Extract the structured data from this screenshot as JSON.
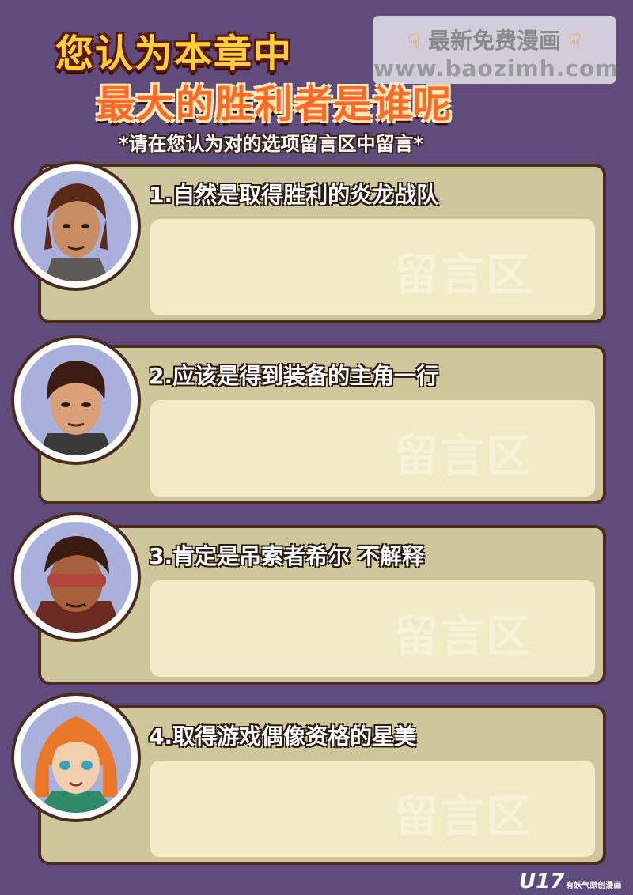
{
  "header": {
    "title_line1": "您认为本章中",
    "title_line2": "最大的胜利者是谁呢",
    "subtitle": "*请在您认为对的选项留言区中留言*"
  },
  "watermark": {
    "line1": "最新免费漫画",
    "line2": "www.baozimh.com"
  },
  "options": [
    {
      "label": "1.自然是取得胜利的炎龙战队",
      "comment_area": "留言区"
    },
    {
      "label": "2.应该是得到装备的主角一行",
      "comment_area": "留言区"
    },
    {
      "label": "3.肯定是吊索者希尔 不解释",
      "comment_area": "留言区"
    },
    {
      "label": "4.取得游戏偶像资格的星美",
      "comment_area": "留言区"
    }
  ],
  "footer": {
    "logo": "U17",
    "logo_sub": "有妖气原创漫画"
  },
  "colors": {
    "background": "#5f4b7c",
    "card": "#cfc79c",
    "comment_area": "#f1ebc6",
    "title_yellow": "#ffcf3a",
    "title_orange": "#ff6a2a"
  }
}
